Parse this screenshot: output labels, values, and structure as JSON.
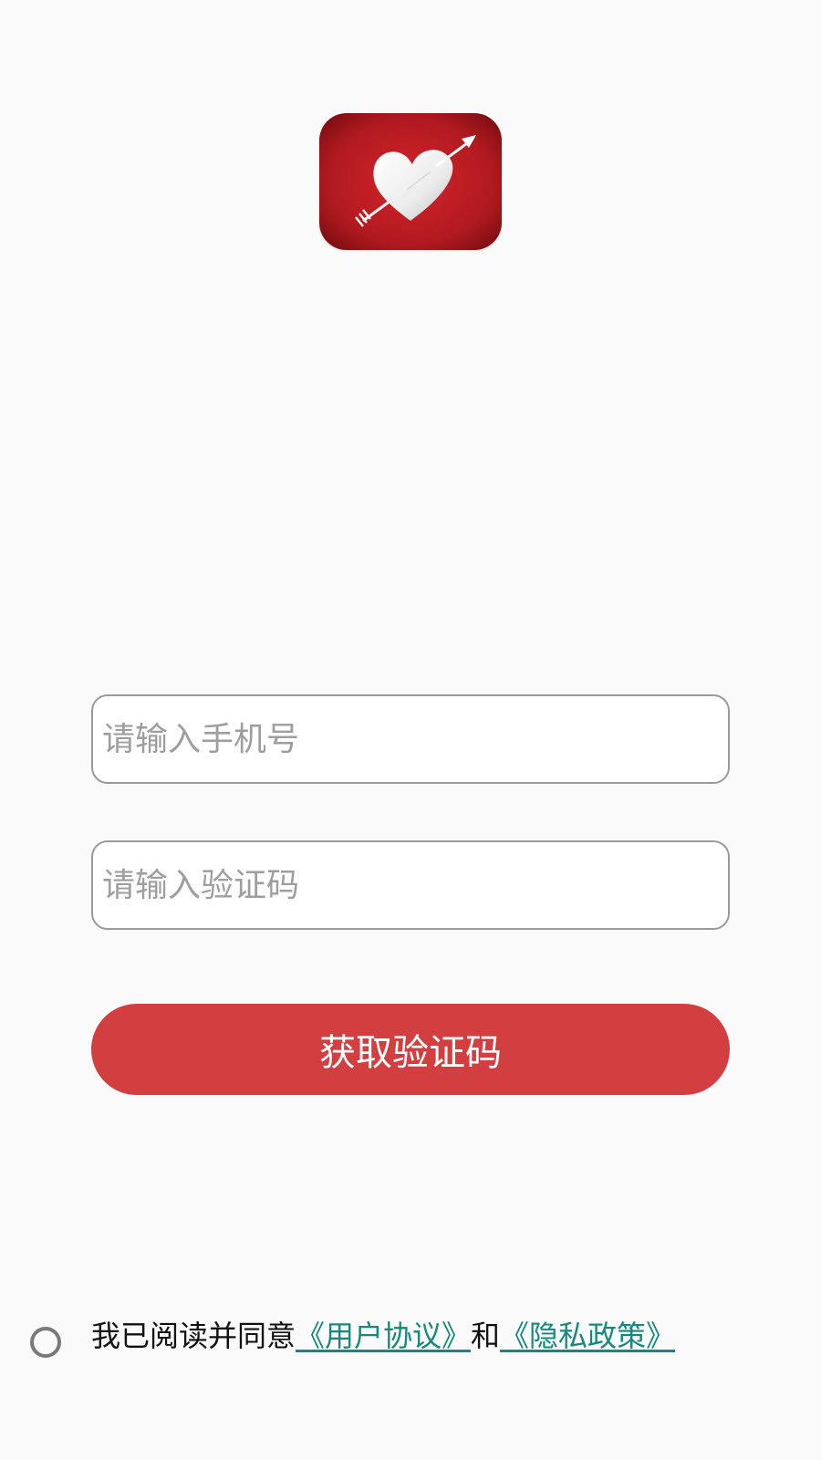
{
  "logo": {
    "icon": "heart-with-arrow",
    "background_color": "#b01a1f"
  },
  "form": {
    "phone_placeholder": "请输入手机号",
    "code_placeholder": "请输入验证码",
    "get_code_label": "获取验证码"
  },
  "agreement": {
    "checked": false,
    "prefix": "我已阅读并同意",
    "user_agreement": "《用户协议》",
    "and": "和",
    "privacy_policy": "《隐私政策》"
  },
  "colors": {
    "accent": "#d33f40",
    "link": "#17897c",
    "background": "#fafafa"
  }
}
